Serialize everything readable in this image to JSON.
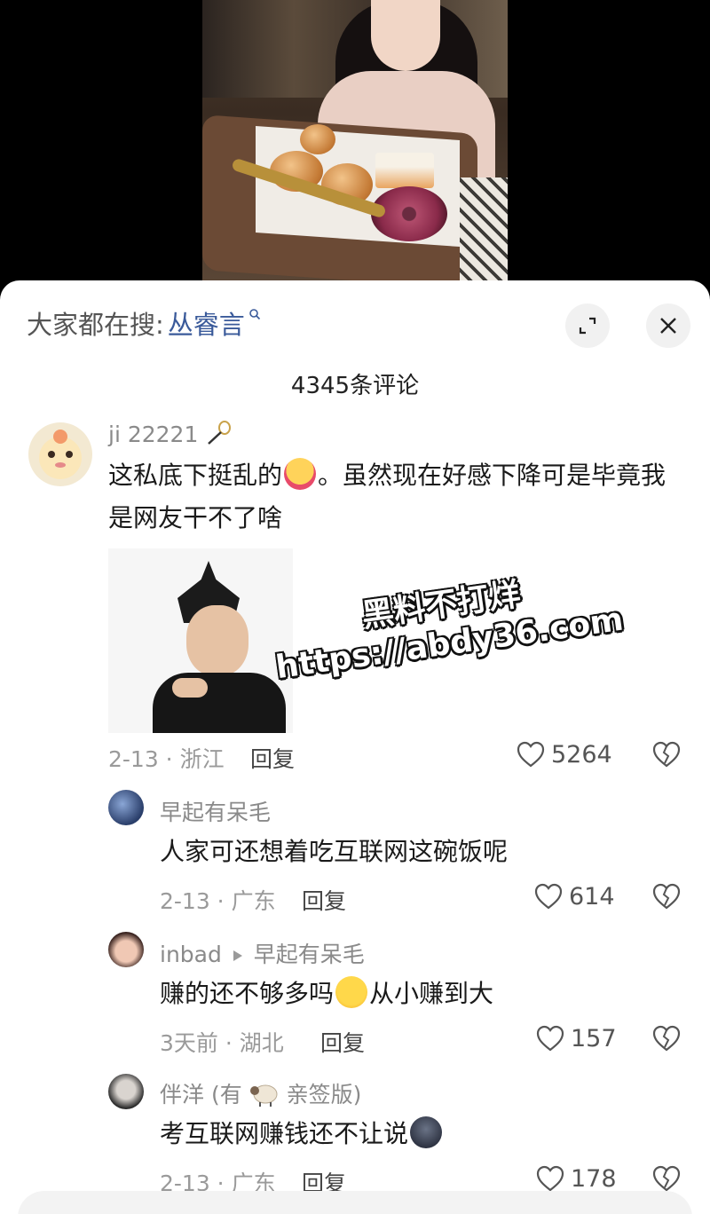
{
  "sheet": {
    "search_prefix": "大家都在搜:",
    "search_term": "丛睿言",
    "comment_count": "4345条评论"
  },
  "watermark": {
    "line1": "黑料不打烊",
    "line2": "https://abdy36.com"
  },
  "comments": [
    {
      "username": "ji 22221",
      "text_before_emoji": "这私底下挺乱的",
      "text_after_emoji": "。虽然现在好感下降可是毕竟我是网友干不了啥",
      "date_location": "2-13 · 浙江",
      "reply_label": "回复",
      "likes": "5264"
    },
    {
      "username": "早起有呆毛",
      "text": "人家可还想着吃互联网这碗饭呢",
      "date_location": "2-13 · 广东",
      "reply_label": "回复",
      "likes": "614"
    },
    {
      "username": "inbad",
      "reply_to": "早起有呆毛",
      "text_before_emoji": "赚的还不够多吗",
      "text_after_emoji": "从小赚到大",
      "date_location": "3天前 · 湖北",
      "reply_label": "回复",
      "likes": "157"
    },
    {
      "username_before_icon": "伴洋 (有",
      "username_after_icon": "亲签版)",
      "text": "考互联网赚钱还不让说",
      "date_location": "2-13 · 广东",
      "reply_label": "回复",
      "likes": "178"
    }
  ],
  "icons": {
    "expand": "expand-icon",
    "close": "close-icon",
    "like": "heart-icon",
    "dislike": "broken-heart-icon"
  }
}
